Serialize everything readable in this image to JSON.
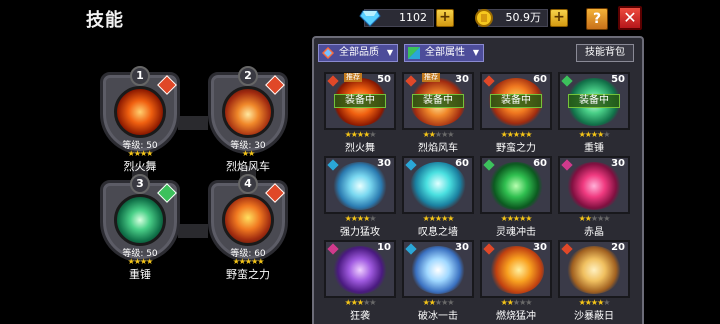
{
  "header": {
    "title": "技能",
    "gems": "1102",
    "gold": "50.9万",
    "help_label": "?",
    "close_label": "✕",
    "plus_label": "+"
  },
  "equipped": [
    {
      "num": "1",
      "level": "等级: 50",
      "stars": 4,
      "name": "烈火舞",
      "element": "fire",
      "orb": "radial-gradient(circle at 50% 50%, #ffd070 0%, #f06010 35%, #8a1800 70%, #200800 100%)"
    },
    {
      "num": "2",
      "level": "等级: 30",
      "stars": 2,
      "name": "烈焰风车",
      "element": "fire",
      "orb": "radial-gradient(circle at 50% 55%, #ffe8a0 0%, #f0882a 30%, #a02a10 65%, #2a0800 100%)"
    },
    {
      "num": "3",
      "level": "等级: 50",
      "stars": 4,
      "name": "重锤",
      "element": "wood",
      "orb": "radial-gradient(circle at 50% 50%, #d8ffe0 0%, #4ad088 30%, #107048 65%, #041a10 100%)"
    },
    {
      "num": "4",
      "level": "等级: 60",
      "stars": 5,
      "name": "野蛮之力",
      "element": "fire",
      "orb": "radial-gradient(circle at 50% 45%, #ffe060 0%, #f07820 35%, #a02c10 65%, #2a0a00 100%)"
    }
  ],
  "filters": {
    "quality": "全部品质",
    "attribute": "全部属性",
    "bag": "技能背包"
  },
  "equipped_label": "装备中",
  "recommend_label": "推荐",
  "skills": [
    {
      "name": "烈火舞",
      "level": "50",
      "stars": 4,
      "element": "fire",
      "equipped": true,
      "tag": true,
      "art": "radial-gradient(circle at 50% 50%, #ffd070 0%, #f06010 35%, #8a1800 65%, #3a3a48 72%)"
    },
    {
      "name": "烈焰风车",
      "level": "30",
      "stars": 2,
      "element": "fire",
      "equipped": true,
      "tag": true,
      "art": "radial-gradient(circle at 50% 55%, #ffe8a0 0%, #f0882a 30%, #a02a10 62%, #3a3a48 72%)"
    },
    {
      "name": "野蛮之力",
      "level": "60",
      "stars": 5,
      "element": "fire",
      "equipped": true,
      "tag": false,
      "art": "radial-gradient(circle at 50% 45%, #ffe060 0%, #f07820 35%, #a02c10 62%, #3a3a48 72%)"
    },
    {
      "name": "重锤",
      "level": "50",
      "stars": 4,
      "element": "wood",
      "equipped": true,
      "tag": false,
      "art": "radial-gradient(circle at 50% 50%, #d8ffe0 0%, #4ad088 30%, #107048 62%, #3a3a48 72%)"
    },
    {
      "name": "强力猛攻",
      "level": "30",
      "stars": 4,
      "element": "water",
      "equipped": false,
      "tag": false,
      "art": "radial-gradient(circle at 50% 50%, #e8ffff 0%, #7ad8f0 28%, #2a7ab0 58%, #3a3a48 72%)"
    },
    {
      "name": "叹息之墙",
      "level": "60",
      "stars": 5,
      "element": "water",
      "equipped": false,
      "tag": false,
      "art": "radial-gradient(circle at 50% 45%, #e0ffff 0%, #4ae0e0 30%, #1a80a0 58%, #3a3a48 72%)"
    },
    {
      "name": "灵魂冲击",
      "level": "60",
      "stars": 5,
      "element": "wood",
      "equipped": false,
      "tag": false,
      "art": "radial-gradient(circle at 50% 50%, #b8ffb0 0%, #30c050 30%, #0c5a20 60%, #3a3a48 72%)"
    },
    {
      "name": "赤晶",
      "level": "30",
      "stars": 2,
      "element": "dark",
      "equipped": false,
      "tag": false,
      "art": "radial-gradient(circle at 50% 50%, #ffb0d8 0%, #f03a80 30%, #801040 60%, #3a3a48 72%)"
    },
    {
      "name": "狂袭",
      "level": "10",
      "stars": 3,
      "element": "dark",
      "equipped": false,
      "tag": false,
      "art": "radial-gradient(circle at 50% 50%, #f0d0ff 0%, #a05ae0 30%, #4a1a80 60%, #3a3a48 72%)"
    },
    {
      "name": "破冰一击",
      "level": "30",
      "stars": 2,
      "element": "water",
      "equipped": false,
      "tag": false,
      "art": "radial-gradient(circle at 50% 50%, #ffffff 0%, #a0d8ff 30%, #3a70c0 60%, #3a3a48 72%)"
    },
    {
      "name": "燃烧猛冲",
      "level": "30",
      "stars": 2,
      "element": "fire",
      "equipped": false,
      "tag": false,
      "art": "radial-gradient(circle at 55% 50%, #fff0a0 0%, #f8a020 30%, #c04010 58%, #3a3a48 72%)"
    },
    {
      "name": "沙暴蔽日",
      "level": "20",
      "stars": 4,
      "element": "fire",
      "equipped": false,
      "tag": false,
      "art": "radial-gradient(circle at 50% 50%, #fff0c0 0%, #f0c060 30%, #a06020 60%, #3a3a48 72%)"
    }
  ]
}
